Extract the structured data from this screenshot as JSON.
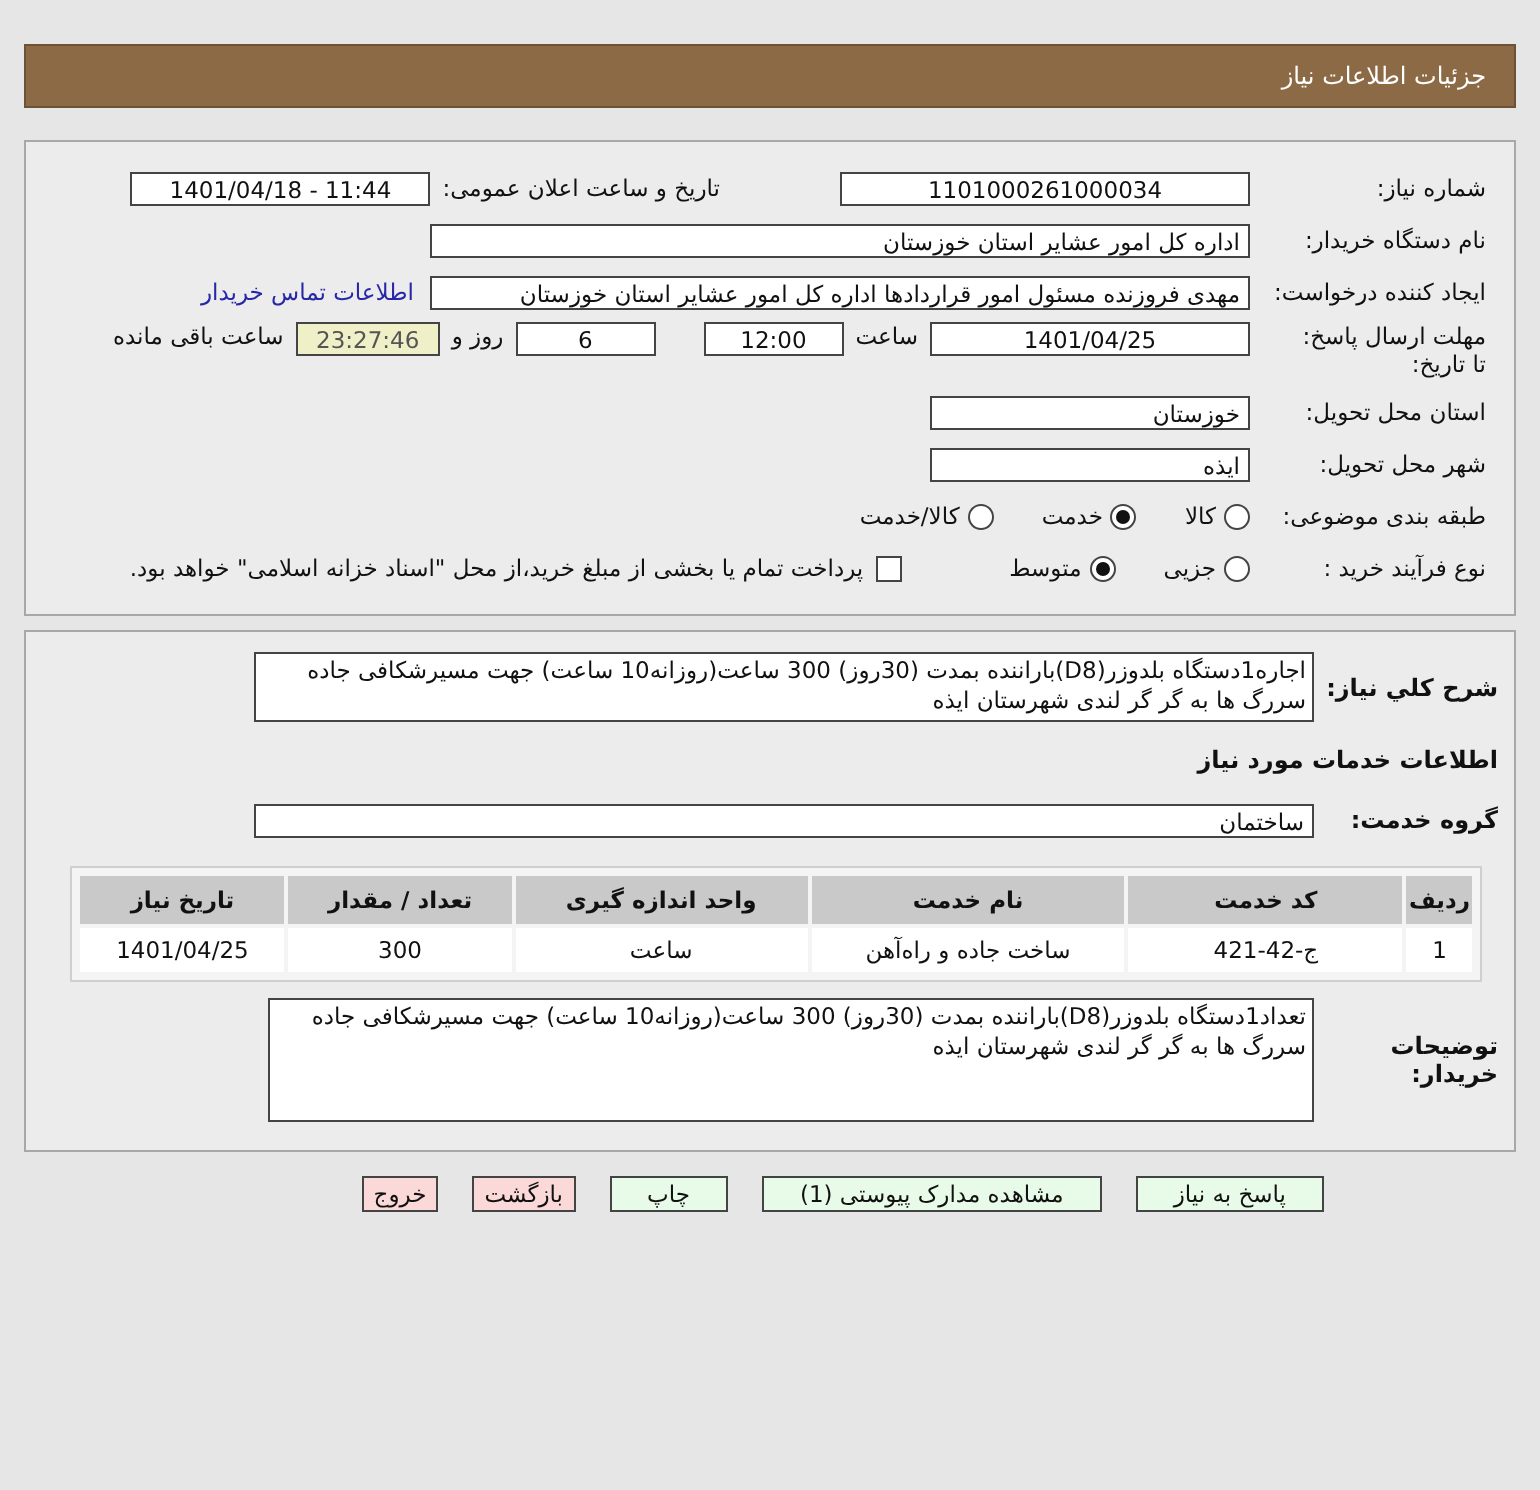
{
  "header": {
    "title": "جزئیات اطلاعات نیاز"
  },
  "details": {
    "need_number": {
      "label": "شماره نیاز:",
      "value": "1101000261000034"
    },
    "announce": {
      "label": "تاریخ و ساعت اعلان عمومی:",
      "value": "1401/04/18 - 11:44"
    },
    "buyer_org": {
      "label": "نام دستگاه خریدار:",
      "value": "اداره کل امور عشایر استان خوزستان"
    },
    "requester": {
      "label": "ایجاد کننده درخواست:",
      "value": "مهدی فروزنده مسئول امور قراردادها اداره کل امور عشایر استان خوزستان",
      "link": "اطلاعات تماس خریدار"
    },
    "deadline": {
      "label": "مهلت ارسال پاسخ: تا تاریخ:",
      "date": "1401/04/25",
      "time_label": "ساعت",
      "time": "12:00",
      "days": "6",
      "days_label": "روز و",
      "remaining": "23:27:46",
      "remaining_label": "ساعت باقی مانده"
    },
    "province": {
      "label": "استان محل تحویل:",
      "value": "خوزستان"
    },
    "city": {
      "label": "شهر محل تحویل:",
      "value": "ایذه"
    },
    "category": {
      "label": "طبقه بندی موضوعی:",
      "options": [
        {
          "label": "کالا",
          "selected": false
        },
        {
          "label": "خدمت",
          "selected": true
        },
        {
          "label": "کالا/خدمت",
          "selected": false
        }
      ]
    },
    "process": {
      "label": "نوع فرآیند خرید :",
      "options": [
        {
          "label": "جزیی",
          "selected": false
        },
        {
          "label": "متوسط",
          "selected": true
        }
      ],
      "checkbox": {
        "label": "پرداخت تمام یا بخشی از مبلغ خرید،از محل \"اسناد خزانه اسلامی\" خواهد بود.",
        "checked": false
      }
    }
  },
  "summary": {
    "label": "شرح کلي نياز:",
    "text": "اجاره1دستگاه بلدوزر(D8)باراننده بمدت (30روز)  300 ساعت(روزانه10 ساعت) جهت مسیرشکافی جاده سررگ ها به گر گر لندی شهرستان ایذه"
  },
  "services_heading": "اطلاعات خدمات مورد نیاز",
  "service_group": {
    "label": "گروه خدمت:",
    "value": "ساختمان"
  },
  "table": {
    "columns": [
      "ردیف",
      "کد خدمت",
      "نام خدمت",
      "واحد اندازه گیری",
      "تعداد / مقدار",
      "تاریخ نیاز"
    ],
    "rows": [
      [
        "1",
        "ج-42-421",
        "ساخت جاده و راه‌آهن",
        "ساعت",
        "300",
        "1401/04/25"
      ]
    ]
  },
  "buyer_notes": {
    "label": "توضیحات خریدار:",
    "text": "تعداد1دستگاه بلدوزر(D8)باراننده بمدت (30روز)  300 ساعت(روزانه10 ساعت) جهت مسیرشکافی جاده سررگ ها به گر گر لندی شهرستان ایذه"
  },
  "buttons": [
    {
      "label": "پاسخ به نیاز",
      "kind": "action"
    },
    {
      "label": "مشاهده مدارک پیوستی (1)",
      "kind": "action"
    },
    {
      "label": "چاپ",
      "kind": "action"
    },
    {
      "label": "بازگشت",
      "kind": "exit"
    },
    {
      "label": "خروج",
      "kind": "exit"
    }
  ]
}
